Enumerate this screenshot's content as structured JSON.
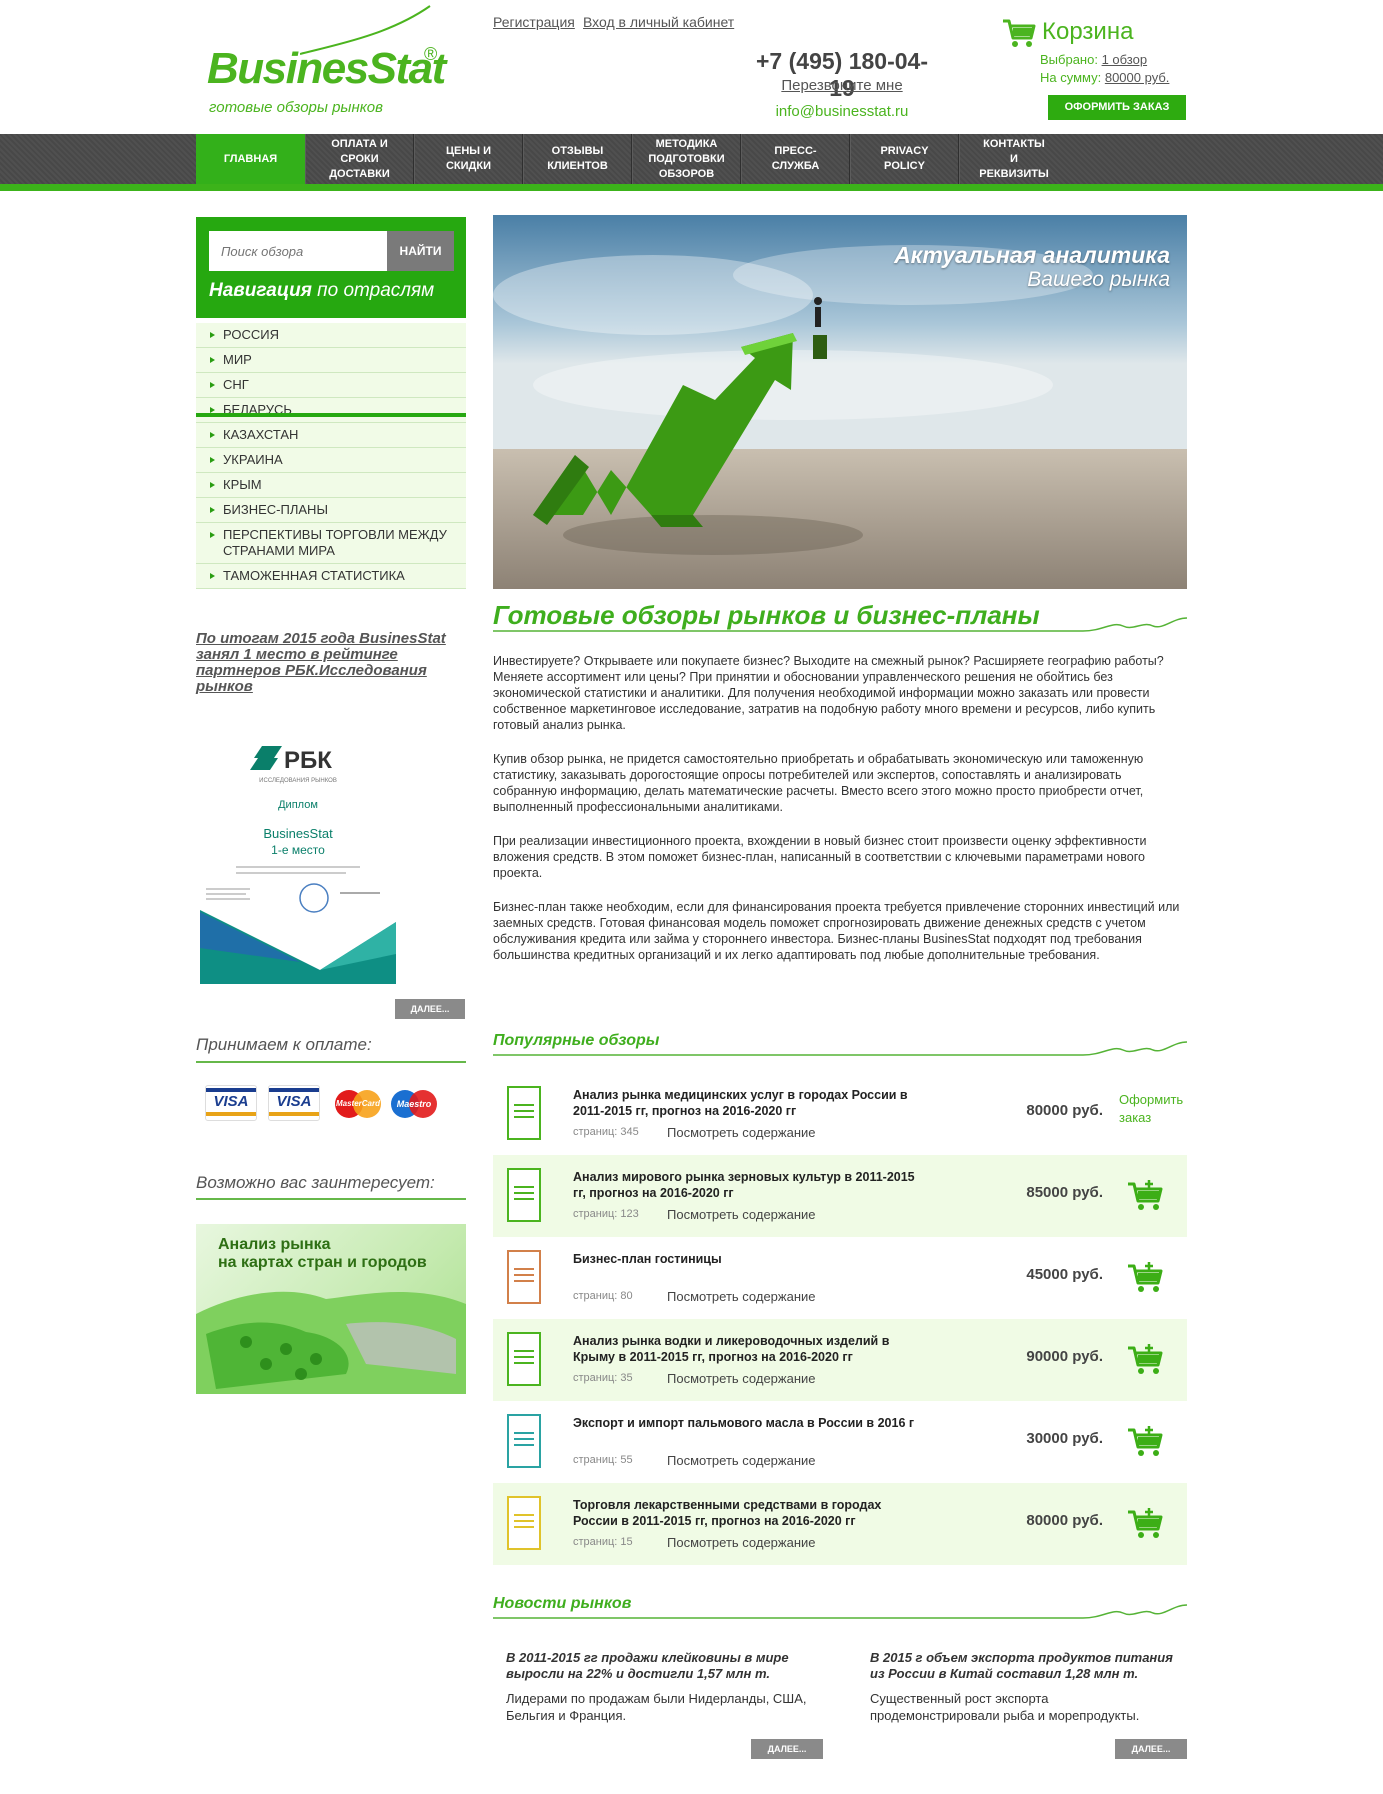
{
  "brand": {
    "name": "BusinesStat",
    "reg": "®",
    "tagline": "готовые обзоры рынков"
  },
  "top_links": {
    "register": "Регистрация",
    "login": "Вход в личный кабинет"
  },
  "contact": {
    "phone": "+7 (495) 180-04-19",
    "callback": "Перезвоните мне",
    "email": "info@businesstat.ru"
  },
  "cart": {
    "title": "Корзина",
    "selected_label": "Выбрано:",
    "selected_value": "1 обзор",
    "sum_label": "На сумму:",
    "sum_value": "80000 руб.",
    "order_button": "ОФОРМИТЬ ЗАКАЗ"
  },
  "nav": [
    {
      "line1": "ГЛАВНАЯ",
      "line2": "",
      "line3": "",
      "active": true
    },
    {
      "line1": "ОПЛАТА И",
      "line2": "СРОКИ",
      "line3": "ДОСТАВКИ"
    },
    {
      "line1": "ЦЕНЫ И",
      "line2": "СКИДКИ",
      "line3": ""
    },
    {
      "line1": "ОТЗЫВЫ",
      "line2": "КЛИЕНТОВ",
      "line3": ""
    },
    {
      "line1": "МЕТОДИКА",
      "line2": "ПОДГОТОВКИ",
      "line3": "ОБЗОРОВ"
    },
    {
      "line1": "ПРЕСС-",
      "line2": "СЛУЖБА",
      "line3": ""
    },
    {
      "line1": "PRIVACY",
      "line2": "POLICY",
      "line3": ""
    },
    {
      "line1": "КОНТАКТЫ",
      "line2": "И",
      "line3": "РЕКВИЗИТЫ"
    }
  ],
  "search": {
    "placeholder": "Поиск обзора",
    "button": "НАЙТИ"
  },
  "sidebar": {
    "nav_title_bold": "Навигация",
    "nav_title_rest": " по отраслям",
    "categories": [
      "РОССИЯ",
      "МИР",
      "СНГ",
      "БЕЛАРУСЬ",
      "КАЗАХСТАН",
      "УКРАИНА",
      "КРЫМ",
      "БИЗНЕС-ПЛАНЫ",
      "ПЕРСПЕКТИВЫ ТОРГОВЛИ МЕЖДУ СТРАНАМИ МИРА",
      "ТАМОЖЕННАЯ СТАТИСТИКА"
    ],
    "rbk_link": "По итогам 2015 года BusinesStat занял 1 место в рейтинге партнеров РБК.Исследования рынков",
    "diploma": {
      "logo": "РБК",
      "sub": "ИССЛЕДОВАНИЯ РЫНКОВ",
      "title": "Диплом",
      "company": "BusinesStat",
      "place": "1-е место"
    },
    "more": "ДАЛЕЕ...",
    "payment_heading": "Принимаем к оплате:",
    "cards": [
      "VISA",
      "VISA",
      "MasterCard",
      "Maestro"
    ],
    "interest_heading": "Возможно вас заинтересует:",
    "map_banner": {
      "line1": "Анализ рынка",
      "line2": "на картах стран и городов"
    }
  },
  "hero": {
    "line1": "Актуальная аналитика",
    "line2": "Вашего рынка"
  },
  "main": {
    "heading": "Готовые обзоры рынков и бизнес-планы",
    "paragraphs": [
      "Инвестируете? Открываете или покупаете бизнес? Выходите на смежный рынок? Расширяете географию работы? Меняете ассортимент или цены? При принятии и обосновании управленческого решения не обойтись без экономической статистики и аналитики. Для получения необходимой информации можно заказать или провести собственное маркетинговое исследование, затратив на подобную работу много времени и ресурсов, либо купить готовый анализ рынка.",
      "Купив обзор рынка, не придется самостоятельно приобретать и обрабатывать экономическую или таможенную статистику, заказывать дорогостоящие опросы потребителей или экспертов, сопоставлять и анализировать собранную информацию, делать математические расчеты. Вместо всего этого можно просто приобрести отчет, выполненный профессиональными аналитиками.",
      "При реализации инвестиционного проекта, вхождении в новый бизнес стоит произвести оценку эффективности вложения средств. В этом поможет бизнес-план, написанный в соответствии с ключевыми параметрами нового проекта.",
      "Бизнес-план также необходим, если для финансирования проекта требуется привлечение сторонних инвестиций или заемных средств. Готовая финансовая модель поможет спрогнозировать движение денежных средств с учетом обслуживания кредита или займа у стороннего инвестора. Бизнес-планы BusinesStat подходят под требования большинства кредитных организаций и их легко адаптировать под любые дополнительные требования."
    ],
    "popular_heading": "Популярные обзоры",
    "products": [
      {
        "title": "Анализ рынка медицинских услуг в городах России в 2011-2015 гг, прогноз на 2016-2020 гг",
        "pages": "страниц: 345",
        "toc": "Посмотреть содержание",
        "price": "80000 руб.",
        "order": "Оформить заказ",
        "color": "#4bb41f"
      },
      {
        "title": "Анализ мирового рынка зерновых культур в 2011-2015 гг, прогноз на 2016-2020 гг",
        "pages": "страниц: 123",
        "toc": "Посмотреть содержание",
        "price": "85000 руб.",
        "color": "#4bb41f"
      },
      {
        "title": "Бизнес-план гостиницы",
        "pages": "страниц: 80",
        "toc": "Посмотреть содержание",
        "price": "45000 руб.",
        "color": "#d2804a"
      },
      {
        "title": "Анализ рынка водки и ликероводочных изделий в Крыму в 2011-2015 гг, прогноз на 2016-2020 гг",
        "pages": "страниц: 35",
        "toc": "Посмотреть содержание",
        "price": "90000 руб.",
        "color": "#4bb41f"
      },
      {
        "title": "Экспорт и импорт пальмового масла в России в 2016 г",
        "pages": "страниц: 55",
        "toc": "Посмотреть содержание",
        "price": "30000 руб.",
        "color": "#2aa3a3"
      },
      {
        "title": "Торговля лекарственными средствами в городах России в 2011-2015 гг, прогноз на 2016-2020 гг",
        "pages": "страниц: 15",
        "toc": "Посмотреть содержание",
        "price": "80000 руб.",
        "color": "#e0c32a"
      }
    ],
    "news_heading": "Новости рынков",
    "news": [
      {
        "title": "В 2011-2015 гг продажи клейковины в мире выросли на 22% и достигли 1,57 млн т.",
        "text": "Лидерами по продажам были Нидерланды, США, Бельгия и Франция.",
        "more": "ДАЛЕЕ..."
      },
      {
        "title": "В 2015 г объем экспорта продуктов питания из России в Китай составил 1,28 млн т.",
        "text": "Существенный рост экспорта продемонстрировали рыба и морепродукты.",
        "more": "ДАЛЕЕ..."
      }
    ]
  }
}
